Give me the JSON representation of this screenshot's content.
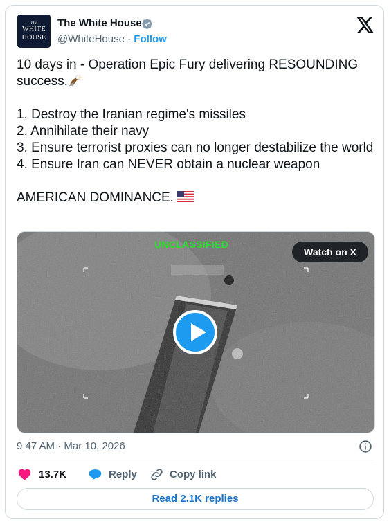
{
  "author": {
    "avatar_text_line1": "The",
    "avatar_text_line2": "WHITE",
    "avatar_text_line3": "HOUSE",
    "name": "The White House",
    "handle": "@WhiteHouse",
    "separator": "·",
    "follow_label": "Follow",
    "verified_icon": "verified-badge-icon",
    "platform_icon": "x-logo-icon"
  },
  "tweet": {
    "line1": "10 days in - Operation Epic Fury delivering RESOUNDING success.",
    "line1_emoji": "eagle-emoji",
    "items": [
      "1. Destroy the Iranian regime's missiles",
      "2. Annihilate their navy",
      "3. Ensure terrorist proxies can no longer destabilize the world",
      "4. Ensure Iran can NEVER obtain a nuclear weapon"
    ],
    "closing": "AMERICAN DOMINANCE.",
    "closing_emoji": "us-flag-emoji"
  },
  "media": {
    "overlay_text": "UNCLASSIFIED",
    "watch_label": "Watch on X",
    "play_icon": "play-icon"
  },
  "meta": {
    "timestamp": "9:47 AM · Mar 10, 2026",
    "info_icon": "info-icon"
  },
  "actions": {
    "like_count": "13.7K",
    "reply_label": "Reply",
    "copy_label": "Copy link"
  },
  "read_replies_label": "Read 2.1K replies",
  "colors": {
    "accent": "#1d9bf0",
    "like": "#f91880",
    "text": "#0f1419",
    "muted": "#536471",
    "border": "#cfd9de",
    "overlay_green": "#28e028"
  }
}
